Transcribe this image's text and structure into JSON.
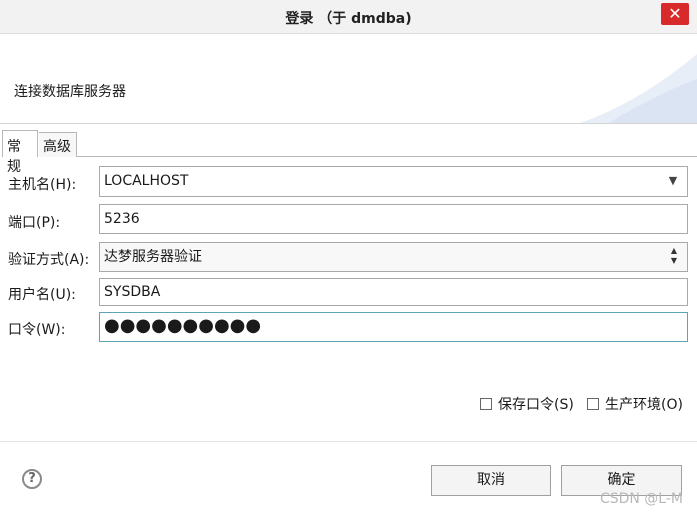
{
  "window": {
    "title": "登录  （于 dmdba)",
    "close_symbol": "✕"
  },
  "header": {
    "description": "连接数据库服务器"
  },
  "tabs": [
    {
      "label": "常规"
    },
    {
      "label": "高级"
    }
  ],
  "form": {
    "host": {
      "label": "主机名(H):",
      "value": "LOCALHOST",
      "arrow": "▼"
    },
    "port": {
      "label": "端口(P):",
      "value": "5236"
    },
    "auth": {
      "label": "验证方式(A):",
      "value": "达梦服务器验证",
      "arrow_up": "▲",
      "arrow_down": "▼"
    },
    "user": {
      "label": "用户名(U):",
      "value": "SYSDBA"
    },
    "password": {
      "label": "口令(W):",
      "value": "●●●●●●●●●●"
    }
  },
  "options": {
    "save_password": {
      "label": "保存口令(S)",
      "checked": false
    },
    "production": {
      "label": "生产环境(O)",
      "checked": false
    }
  },
  "buttons": {
    "help": "?",
    "cancel": "取消",
    "ok": "确定"
  },
  "watermark": "CSDN @L-M"
}
